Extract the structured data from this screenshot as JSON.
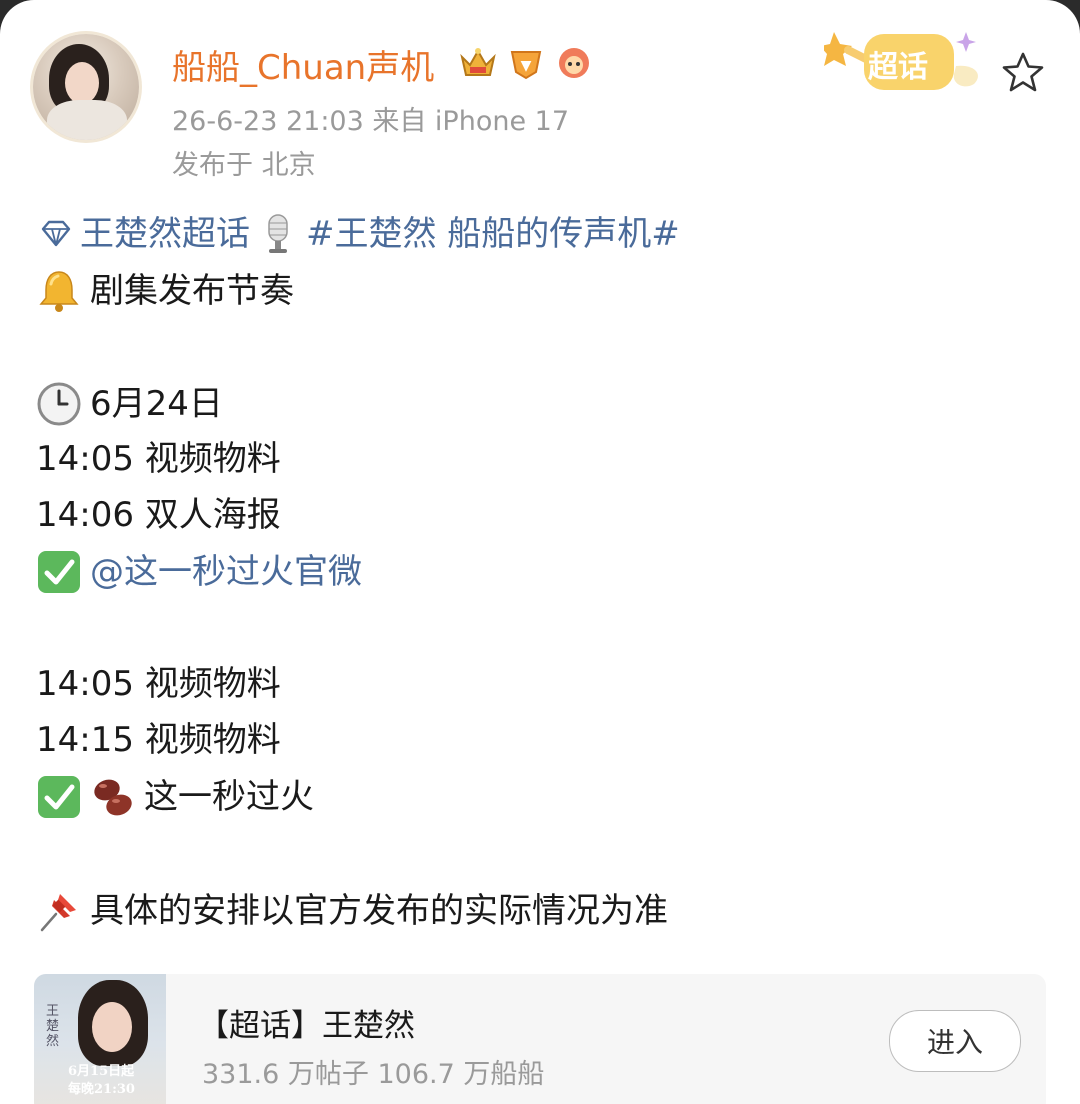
{
  "post": {
    "username": "船船_Chuan声机",
    "timestamp_source": "26-6-23 21:03  来自 iPhone 17",
    "location": "发布于 北京",
    "badge_super": "超话"
  },
  "content": {
    "topic_link": "王楚然超话",
    "hashtag": "#王楚然 船船的传声机#",
    "heading": "剧集发布节奏",
    "date": "6月24日",
    "line_1": "14:05 视频物料",
    "line_2": "14:06 双人海报",
    "mention": "@这一秒过火官微",
    "line_3": "14:05 视频物料",
    "line_4": "14:15 视频物料",
    "line_5": "这一秒过火",
    "note": "具体的安排以官方发布的实际情况为准"
  },
  "topic_card": {
    "title": "【超话】王楚然",
    "stats": "331.6 万帖子  106.7 万船船",
    "enter_label": "进入",
    "thumb_line1": "6月15日起",
    "thumb_line2": "每晚21:30",
    "thumb_side": "王楚然"
  },
  "icons": {
    "topic_diamond": "diamond-icon",
    "microphone": "microphone-icon",
    "bell": "bell-icon",
    "clock": "clock-icon",
    "check": "check-mark-icon",
    "beans": "beans-icon",
    "pin": "pushpin-icon",
    "star": "star-icon"
  },
  "colors": {
    "username": "#e8742b",
    "link": "#4a6b9a",
    "meta": "#9a9a9a",
    "check_green": "#5cb85c"
  }
}
